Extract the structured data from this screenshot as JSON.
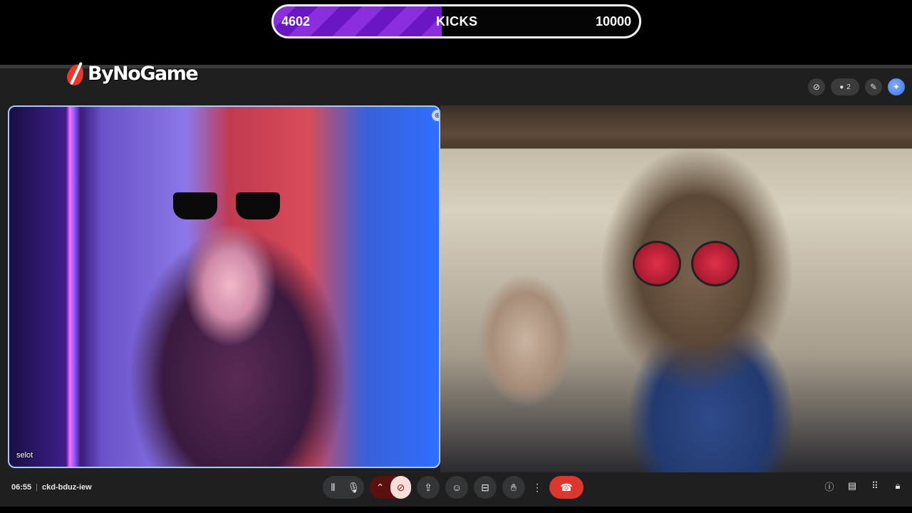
{
  "kicks_bar": {
    "current": "4602",
    "label": "KICKS",
    "goal": "10000",
    "progress_fraction": 0.4602
  },
  "brand": {
    "name": "ByNoGame"
  },
  "top_icons": {
    "participants_count": "2"
  },
  "tiles": [
    {
      "name": "selot"
    },
    {
      "name": ""
    }
  ],
  "meeting": {
    "time": "06:55",
    "separator": "|",
    "code": "ckd-bduz-iew"
  },
  "colors": {
    "accent_purple": "#8a2ee0",
    "hangup_red": "#dc362e",
    "tile_border": "#a8c7fa"
  },
  "icons": {
    "top": [
      "camera-off-icon",
      "participants-icon",
      "edit-icon",
      "gemini-icon"
    ],
    "controls": [
      "audio-levels-icon",
      "microphone-icon",
      "chevron-up-icon",
      "camera-off-icon",
      "present-icon",
      "emoji-icon",
      "captions-icon",
      "raise-hand-icon",
      "more-options-icon",
      "hang-up-icon"
    ],
    "right": [
      "info-icon",
      "chat-icon",
      "activities-icon",
      "host-controls-icon"
    ]
  }
}
